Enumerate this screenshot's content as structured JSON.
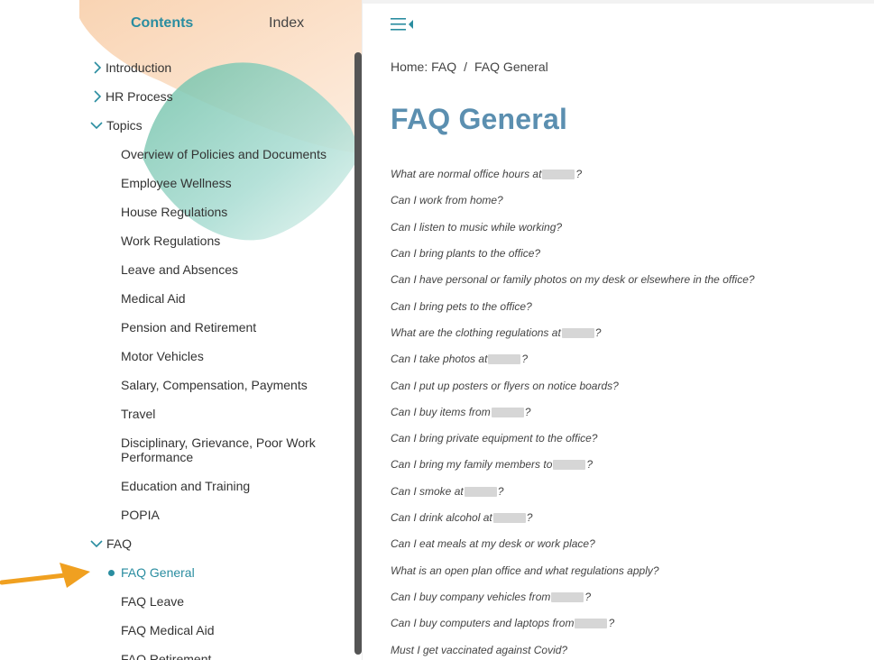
{
  "tabs": {
    "contents": "Contents",
    "index": "Index"
  },
  "tree": {
    "introduction": "Introduction",
    "hr_process": "HR Process",
    "topics": "Topics",
    "topic_items": [
      "Overview of Policies and Documents",
      "Employee Wellness",
      "House Regulations",
      "Work Regulations",
      "Leave and Absences",
      "Medical Aid",
      "Pension and Retirement",
      "Motor Vehicles",
      "Salary, Compensation, Payments",
      "Travel",
      "Disciplinary, Grievance, Poor Work Performance",
      "Education and Training",
      "POPIA"
    ],
    "faq": "FAQ",
    "faq_items": [
      "FAQ General",
      "FAQ Leave",
      "FAQ Medical Aid",
      "FAQ Retirement"
    ]
  },
  "breadcrumb": {
    "home": "Home: FAQ",
    "separator": "/",
    "current": "FAQ General"
  },
  "page_title": "FAQ General",
  "faq": [
    {
      "pre": "What are normal office hours at",
      "post": "?"
    },
    {
      "pre": "Can I work from home?",
      "post": ""
    },
    {
      "pre": "Can I listen to music while working?",
      "post": ""
    },
    {
      "pre": "Can I bring plants to the office?",
      "post": ""
    },
    {
      "pre": "Can I have personal or family photos on my desk or elsewhere in the office?",
      "post": ""
    },
    {
      "pre": "Can I bring pets to the office?",
      "post": ""
    },
    {
      "pre": "What are the clothing regulations at",
      "post": "?"
    },
    {
      "pre": "Can I take photos at",
      "post": "?"
    },
    {
      "pre": "Can I put up posters or flyers on notice boards?",
      "post": ""
    },
    {
      "pre": "Can I buy items from",
      "post": "?"
    },
    {
      "pre": "Can I bring private equipment to the office?",
      "post": ""
    },
    {
      "pre": "Can I bring my family members to",
      "post": "?"
    },
    {
      "pre": "Can I smoke at",
      "post": "?"
    },
    {
      "pre": "Can I drink alcohol at",
      "post": "?"
    },
    {
      "pre": "Can I eat meals at my desk or work place?",
      "post": ""
    },
    {
      "pre": "What is an open plan office and what regulations apply?",
      "post": ""
    },
    {
      "pre": "Can I buy company vehicles from",
      "post": "?"
    },
    {
      "pre": "Can I buy computers and laptops from",
      "post": "?"
    },
    {
      "pre": "Must I get vaccinated against Covid?",
      "post": ""
    }
  ],
  "colors": {
    "accent": "#2a8da0",
    "title": "#5b8fb0",
    "arrow": "#f0a020"
  },
  "icons": [
    "chevron-right-icon",
    "chevron-down-icon",
    "menu-collapse-icon",
    "bullet-icon",
    "pointer-arrow"
  ]
}
